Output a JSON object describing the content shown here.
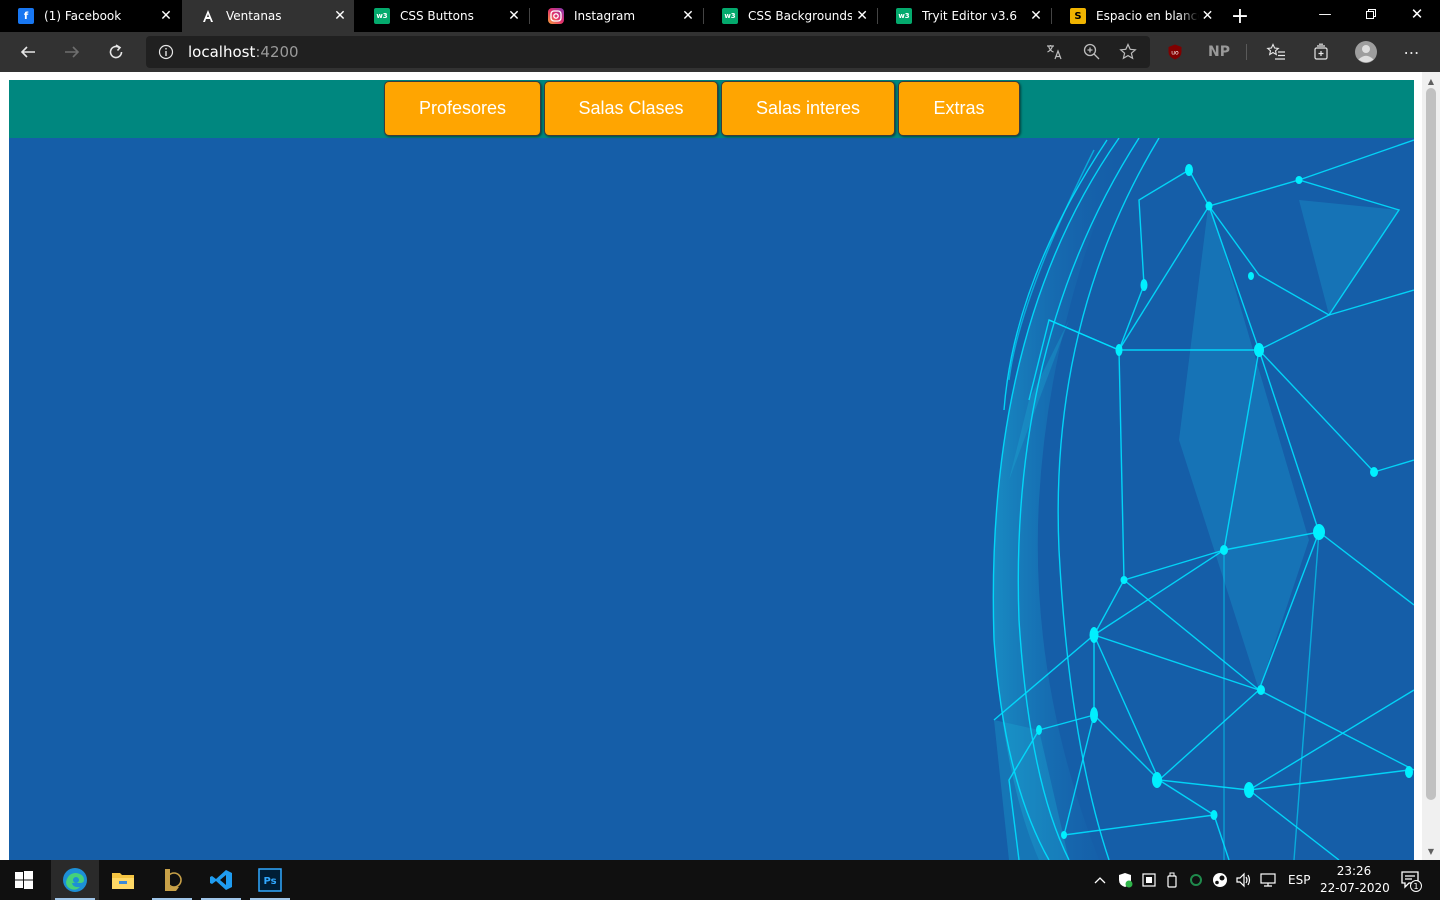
{
  "browser": {
    "tabs": [
      {
        "title": "(1) Facebook",
        "favicon": "facebook-icon",
        "favicon_color": "#1877f2",
        "active": false
      },
      {
        "title": "Ventanas",
        "favicon": "angular-icon",
        "favicon_color": "#ffffff",
        "active": true
      },
      {
        "title": "CSS Buttons",
        "favicon": "w3schools-icon",
        "favicon_color": "#04aa6d",
        "active": false
      },
      {
        "title": "Instagram",
        "favicon": "instagram-icon",
        "favicon_color": "#e1306c",
        "active": false
      },
      {
        "title": "CSS Backgrounds",
        "favicon": "w3schools-icon",
        "favicon_color": "#04aa6d",
        "active": false
      },
      {
        "title": "Tryit Editor v3.6",
        "favicon": "w3schools-icon",
        "favicon_color": "#04aa6d",
        "active": false
      },
      {
        "title": "Espacio en blanco d",
        "favicon": "blogger-icon",
        "favicon_color": "#f0b400",
        "active": false
      }
    ],
    "address": {
      "host": "localhost",
      "port": ":4200"
    }
  },
  "page": {
    "nav_buttons": [
      {
        "label": "Profesores"
      },
      {
        "label": "Salas Clases"
      },
      {
        "label": "Salas interes"
      },
      {
        "label": "Extras"
      }
    ],
    "colors": {
      "background": "#155ea8",
      "nav_bar": "#00877f",
      "button": "#ffa501",
      "globe_lines": "#00e5ff"
    }
  },
  "taskbar": {
    "language": "ESP",
    "time": "23:26",
    "date": "22-07-2020",
    "notification_count": "1",
    "apps": [
      "edge-icon",
      "file-explorer-icon",
      "league-of-legends-icon",
      "vscode-icon",
      "photoshop-icon"
    ]
  }
}
